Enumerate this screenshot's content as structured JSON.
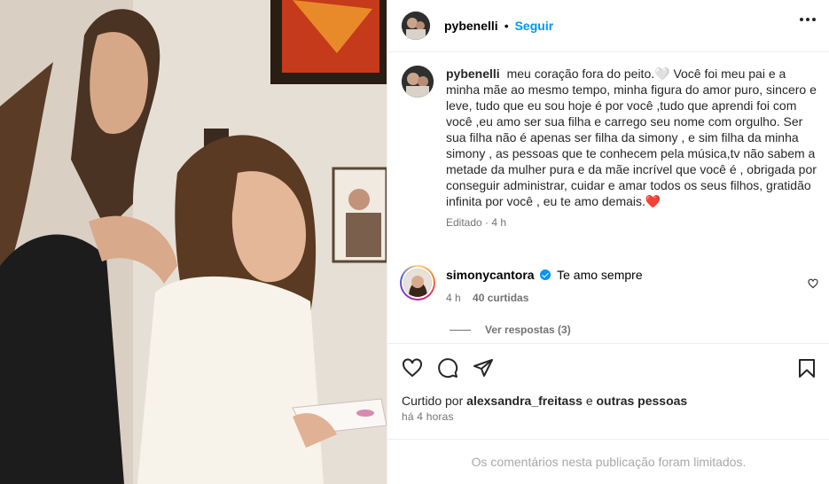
{
  "post": {
    "username": "pybenelli",
    "follow_label": "Seguir",
    "header_separator": "•"
  },
  "caption": {
    "username": "pybenelli",
    "text": "meu coração fora do peito.🤍 Você foi meu pai e a minha mãe ao mesmo tempo, minha figura do amor puro, sincero e leve, tudo que eu sou hoje é por você ,tudo que aprendi foi com você ,eu amo ser sua filha e carrego seu nome com orgulho. Ser sua filha não é apenas ser filha da simony , e sim filha da minha simony , as pessoas que te conhecem pela música,tv não sabem a metade da mulher pura e da mãe incrível que você é , obrigada por conseguir administrar, cuidar e amar todos os seus filhos, gratidão infinita por você , eu te amo demais.❤️",
    "edited_label": "Editado",
    "meta_separator": "·",
    "time": "4 h"
  },
  "comment": {
    "username": "simonycantora",
    "text": "Te amo sempre",
    "time": "4 h",
    "likes": "40 curtidas",
    "view_replies": "Ver respostas (3)"
  },
  "engagement": {
    "liked_by_prefix": "Curtido por",
    "liked_by_user": "alexsandra_freitass",
    "liked_by_and": "e",
    "liked_by_rest": "outras pessoas",
    "posted_ago": "há 4 horas"
  },
  "footer": {
    "notice": "Os comentários nesta publicação foram limitados."
  },
  "icons": {
    "like": "heart-icon",
    "comment": "comment-icon",
    "share": "share-icon",
    "save": "bookmark-icon",
    "more": "more-icon",
    "verified": "verified-icon"
  },
  "colors": {
    "accent": "#0095f6",
    "secondary_text": "#737373",
    "muted_text": "#a8a8a8",
    "divider": "#efefef"
  }
}
